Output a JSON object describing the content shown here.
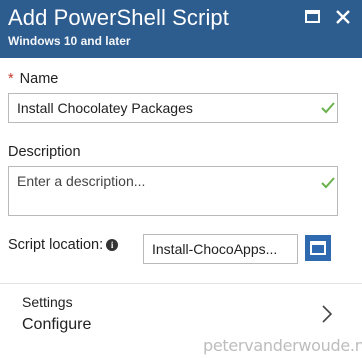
{
  "header": {
    "title": "Add PowerShell Script",
    "subtitle": "Windows 10 and later",
    "background": "#2d5c8f"
  },
  "name_field": {
    "required_marker": "*",
    "label": "Name",
    "value": "Install Chocolatey Packages"
  },
  "description_field": {
    "label": "Description",
    "placeholder": "Enter a description..."
  },
  "script_location": {
    "label": "Script location:",
    "info_icon": "i",
    "value": "Install-ChocoApps...",
    "browse_icon": "folder-browse-icon"
  },
  "settings": {
    "label": "Settings",
    "value": "Configure"
  },
  "watermark": "petervanderwoude.nl",
  "colors": {
    "accent": "#2f6ab1",
    "check": "#6ab04c",
    "required": "#c0392b"
  }
}
